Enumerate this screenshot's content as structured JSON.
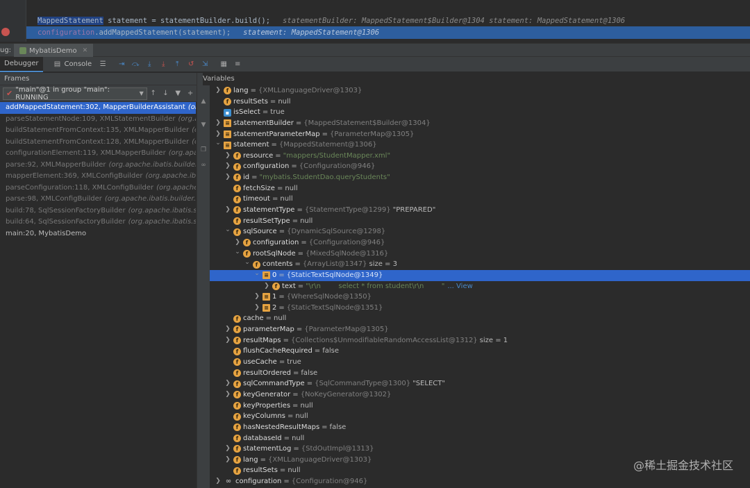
{
  "editor": {
    "line1": {
      "type": "MappedStatement",
      "code": " statement = statementBuilder.build();",
      "inline": "statementBuilder: MappedStatement$Builder@1304   statement: MappedStatement@1306"
    },
    "line2": {
      "field": "configuration",
      "code": ".addMappedStatement(statement);",
      "inline": "statement: MappedStatement@1306"
    }
  },
  "tool_window": {
    "debug_label": "ug:",
    "run_tab": "MybatisDemo",
    "tabs": [
      "Debugger",
      "Console"
    ]
  },
  "frames": {
    "title": "Frames",
    "thread": "\"main\"@1 in group \"main\": RUNNING",
    "items": [
      {
        "method": "addMappedStatement:302, MapperBuilderAssistant",
        "pkg": "(org.ap"
      },
      {
        "method": "parseStatementNode:109, XMLStatementBuilder",
        "pkg": "(org.apache"
      },
      {
        "method": "buildStatementFromContext:135, XMLMapperBuilder",
        "pkg": "(org.a"
      },
      {
        "method": "buildStatementFromContext:128, XMLMapperBuilder",
        "pkg": "(org.a"
      },
      {
        "method": "configurationElement:119, XMLMapperBuilder",
        "pkg": "(org.apache."
      },
      {
        "method": "parse:92, XMLMapperBuilder",
        "pkg": "(org.apache.ibatis.builder.xml"
      },
      {
        "method": "mapperElement:369, XMLConfigBuilder",
        "pkg": "(org.apache.ibatis.bu"
      },
      {
        "method": "parseConfiguration:118, XMLConfigBuilder",
        "pkg": "(org.apache.ibat"
      },
      {
        "method": "parse:98, XMLConfigBuilder",
        "pkg": "(org.apache.ibatis.builder.xml)"
      },
      {
        "method": "build:78, SqlSessionFactoryBuilder",
        "pkg": "(org.apache.ibatis.sessio"
      },
      {
        "method": "build:64, SqlSessionFactoryBuilder",
        "pkg": "(org.apache.ibatis.sessio"
      },
      {
        "method": "main:20, MybatisDemo",
        "pkg": ""
      }
    ]
  },
  "variables": {
    "title": "Variables",
    "rows": [
      {
        "d": 0,
        "t": ">",
        "i": "f",
        "n": "lang",
        "ty": "{XMLLanguageDriver@1303}",
        "v": "",
        "s": ""
      },
      {
        "d": 0,
        "t": "",
        "i": "f",
        "n": "resultSets",
        "ty": "",
        "v": "null",
        "s": ""
      },
      {
        "d": 0,
        "t": "",
        "i": "b",
        "n": "isSelect",
        "ty": "",
        "v": "true",
        "s": ""
      },
      {
        "d": 0,
        "t": ">",
        "i": "l",
        "n": "statementBuilder",
        "ty": "{MappedStatement$Builder@1304}",
        "v": "",
        "s": ""
      },
      {
        "d": 0,
        "t": ">",
        "i": "l",
        "n": "statementParameterMap",
        "ty": "{ParameterMap@1305}",
        "v": "",
        "s": ""
      },
      {
        "d": 0,
        "t": "v",
        "i": "l",
        "n": "statement",
        "ty": "{MappedStatement@1306}",
        "v": "",
        "s": ""
      },
      {
        "d": 1,
        "t": ">",
        "i": "f",
        "n": "resource",
        "ty": "",
        "v": "",
        "s": "\"mappers/StudentMapper.xml\""
      },
      {
        "d": 1,
        "t": ">",
        "i": "f",
        "n": "configuration",
        "ty": "{Configuration@946}",
        "v": "",
        "s": ""
      },
      {
        "d": 1,
        "t": ">",
        "i": "f",
        "n": "id",
        "ty": "",
        "v": "",
        "s": "\"mybatis.StudentDao.queryStudents\""
      },
      {
        "d": 1,
        "t": "",
        "i": "f",
        "n": "fetchSize",
        "ty": "",
        "v": "null",
        "s": ""
      },
      {
        "d": 1,
        "t": "",
        "i": "f",
        "n": "timeout",
        "ty": "",
        "v": "null",
        "s": ""
      },
      {
        "d": 1,
        "t": ">",
        "i": "f",
        "n": "statementType",
        "ty": "{StatementType@1299}",
        "v": "\"PREPARED\"",
        "s": ""
      },
      {
        "d": 1,
        "t": "",
        "i": "f",
        "n": "resultSetType",
        "ty": "",
        "v": "null",
        "s": ""
      },
      {
        "d": 1,
        "t": "v",
        "i": "f",
        "n": "sqlSource",
        "ty": "{DynamicSqlSource@1298}",
        "v": "",
        "s": ""
      },
      {
        "d": 2,
        "t": ">",
        "i": "f",
        "n": "configuration",
        "ty": "{Configuration@946}",
        "v": "",
        "s": ""
      },
      {
        "d": 2,
        "t": "v",
        "i": "f",
        "n": "rootSqlNode",
        "ty": "{MixedSqlNode@1316}",
        "v": "",
        "s": ""
      },
      {
        "d": 3,
        "t": "v",
        "i": "f",
        "n": "contents",
        "ty": "{ArrayList@1347}",
        "v": "size = 3",
        "s": ""
      },
      {
        "d": 4,
        "t": "v",
        "i": "l",
        "n": "0",
        "ty": "{StaticTextSqlNode@1349}",
        "v": "",
        "s": "",
        "sel": true
      },
      {
        "d": 5,
        "t": ">",
        "i": "f",
        "n": "text",
        "ty": "",
        "v": "",
        "s": "\"\\r\\n        select * from student\\r\\n        \"",
        "link": "... View"
      },
      {
        "d": 4,
        "t": ">",
        "i": "l",
        "n": "1",
        "ty": "{WhereSqlNode@1350}",
        "v": "",
        "s": ""
      },
      {
        "d": 4,
        "t": ">",
        "i": "l",
        "n": "2",
        "ty": "{StaticTextSqlNode@1351}",
        "v": "",
        "s": ""
      },
      {
        "d": 1,
        "t": "",
        "i": "f",
        "n": "cache",
        "ty": "",
        "v": "null",
        "s": ""
      },
      {
        "d": 1,
        "t": ">",
        "i": "f",
        "n": "parameterMap",
        "ty": "{ParameterMap@1305}",
        "v": "",
        "s": ""
      },
      {
        "d": 1,
        "t": ">",
        "i": "f",
        "n": "resultMaps",
        "ty": "{Collections$UnmodifiableRandomAccessList@1312}",
        "v": "size = 1",
        "s": ""
      },
      {
        "d": 1,
        "t": "",
        "i": "f",
        "n": "flushCacheRequired",
        "ty": "",
        "v": "false",
        "s": ""
      },
      {
        "d": 1,
        "t": "",
        "i": "f",
        "n": "useCache",
        "ty": "",
        "v": "true",
        "s": ""
      },
      {
        "d": 1,
        "t": "",
        "i": "f",
        "n": "resultOrdered",
        "ty": "",
        "v": "false",
        "s": ""
      },
      {
        "d": 1,
        "t": ">",
        "i": "f",
        "n": "sqlCommandType",
        "ty": "{SqlCommandType@1300}",
        "v": "\"SELECT\"",
        "s": ""
      },
      {
        "d": 1,
        "t": ">",
        "i": "f",
        "n": "keyGenerator",
        "ty": "{NoKeyGenerator@1302}",
        "v": "",
        "s": ""
      },
      {
        "d": 1,
        "t": "",
        "i": "f",
        "n": "keyProperties",
        "ty": "",
        "v": "null",
        "s": ""
      },
      {
        "d": 1,
        "t": "",
        "i": "f",
        "n": "keyColumns",
        "ty": "",
        "v": "null",
        "s": ""
      },
      {
        "d": 1,
        "t": "",
        "i": "f",
        "n": "hasNestedResultMaps",
        "ty": "",
        "v": "false",
        "s": ""
      },
      {
        "d": 1,
        "t": "",
        "i": "f",
        "n": "databaseId",
        "ty": "",
        "v": "null",
        "s": ""
      },
      {
        "d": 1,
        "t": ">",
        "i": "f",
        "n": "statementLog",
        "ty": "{StdOutImpl@1313}",
        "v": "",
        "s": ""
      },
      {
        "d": 1,
        "t": ">",
        "i": "f",
        "n": "lang",
        "ty": "{XMLLanguageDriver@1303}",
        "v": "",
        "s": ""
      },
      {
        "d": 1,
        "t": "",
        "i": "f",
        "n": "resultSets",
        "ty": "",
        "v": "null",
        "s": ""
      },
      {
        "d": 0,
        "t": ">",
        "i": "oo",
        "n": "configuration",
        "ty": "{Configuration@946}",
        "v": "",
        "s": ""
      }
    ]
  },
  "watermark": "@稀土掘金技术社区",
  "colors": {
    "background": "#2b2b2b",
    "panel": "#3c3f41",
    "selection": "#2f65ca",
    "field_icon": "#e6a341",
    "string": "#6a8759",
    "breakpoint": "#c75450"
  }
}
